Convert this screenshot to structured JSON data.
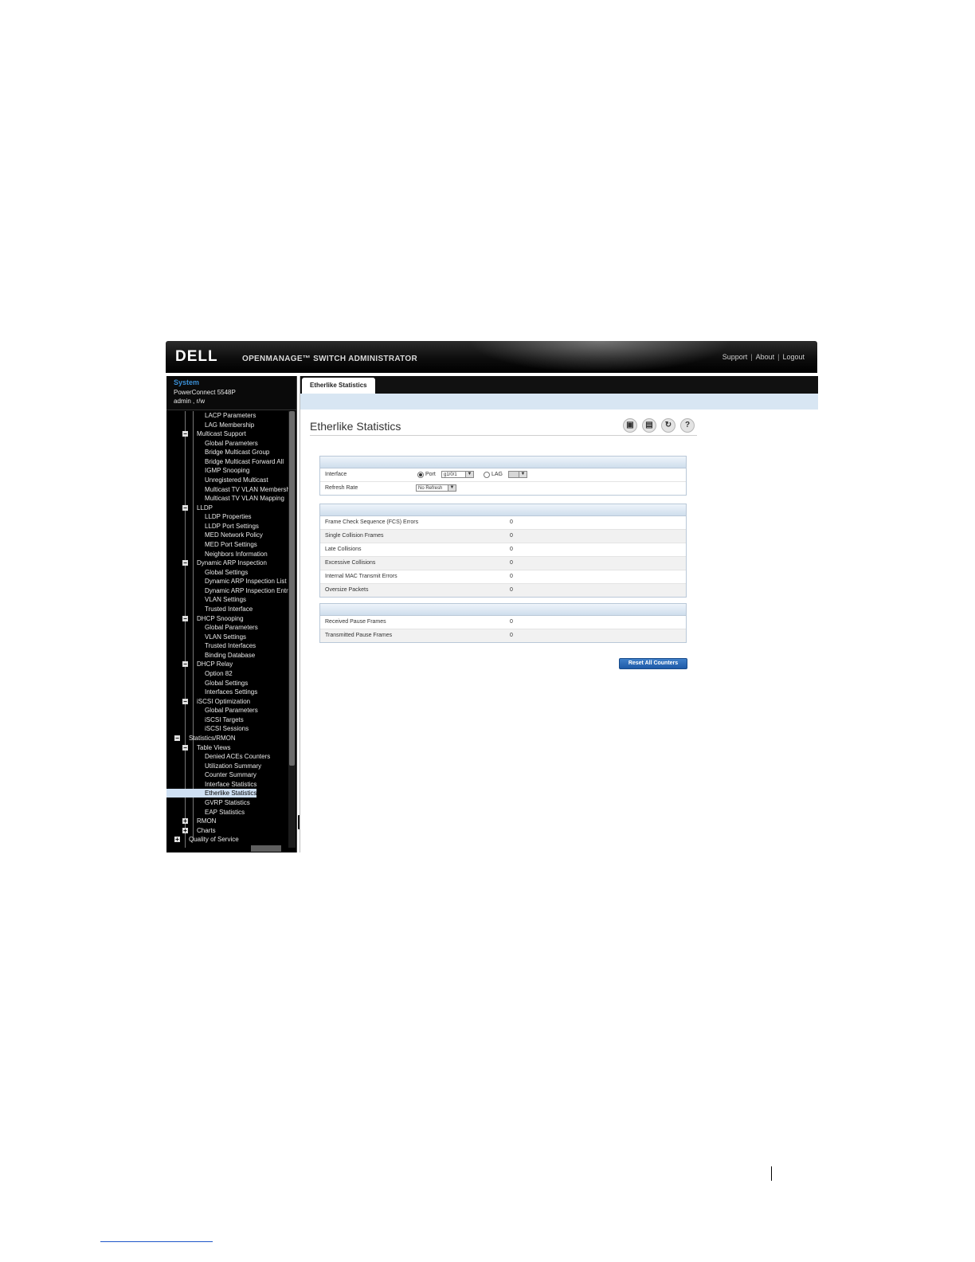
{
  "header": {
    "logo": "DELL",
    "product": "OPENMANAGE™ SWITCH ADMINISTRATOR",
    "links": [
      "Support",
      "About",
      "Logout"
    ]
  },
  "sidebar": {
    "system_title": "System",
    "model": "PowerConnect 5548P",
    "user": "admin , r/w",
    "tree": [
      {
        "label": "LACP Parameters",
        "level": 2
      },
      {
        "label": "LAG Membership",
        "level": 2
      },
      {
        "label": "Multicast Support",
        "level": 1,
        "toggle": "−"
      },
      {
        "label": "Global Parameters",
        "level": 2
      },
      {
        "label": "Bridge Multicast Group",
        "level": 2
      },
      {
        "label": "Bridge Multicast Forward All",
        "level": 2
      },
      {
        "label": "IGMP Snooping",
        "level": 2
      },
      {
        "label": "Unregistered Multicast",
        "level": 2
      },
      {
        "label": "Multicast TV VLAN Membersh",
        "level": 2
      },
      {
        "label": "Multicast TV VLAN Mapping",
        "level": 2
      },
      {
        "label": "LLDP",
        "level": 1,
        "toggle": "−"
      },
      {
        "label": "LLDP Properties",
        "level": 2
      },
      {
        "label": "LLDP Port Settings",
        "level": 2
      },
      {
        "label": "MED Network Policy",
        "level": 2
      },
      {
        "label": "MED Port Settings",
        "level": 2
      },
      {
        "label": "Neighbors Information",
        "level": 2
      },
      {
        "label": "Dynamic ARP Inspection",
        "level": 1,
        "toggle": "−"
      },
      {
        "label": "Global Settings",
        "level": 2
      },
      {
        "label": "Dynamic ARP Inspection List",
        "level": 2
      },
      {
        "label": "Dynamic ARP Inspection Entr",
        "level": 2
      },
      {
        "label": "VLAN Settings",
        "level": 2
      },
      {
        "label": "Trusted Interface",
        "level": 2
      },
      {
        "label": "DHCP Snooping",
        "level": 1,
        "toggle": "−"
      },
      {
        "label": "Global Parameters",
        "level": 2
      },
      {
        "label": "VLAN Settings",
        "level": 2
      },
      {
        "label": "Trusted Interfaces",
        "level": 2
      },
      {
        "label": "Binding Database",
        "level": 2
      },
      {
        "label": "DHCP Relay",
        "level": 1,
        "toggle": "−"
      },
      {
        "label": "Option 82",
        "level": 2
      },
      {
        "label": "Global Settings",
        "level": 2
      },
      {
        "label": "Interfaces Settings",
        "level": 2
      },
      {
        "label": "iSCSI Optimization",
        "level": 1,
        "toggle": "−"
      },
      {
        "label": "Global Parameters",
        "level": 2
      },
      {
        "label": "iSCSI Targets",
        "level": 2
      },
      {
        "label": "iSCSI Sessions",
        "level": 2
      },
      {
        "label": "Statistics/RMON",
        "level": 0,
        "toggle": "−"
      },
      {
        "label": "Table Views",
        "level": 1,
        "toggle": "−"
      },
      {
        "label": "Denied ACEs Counters",
        "level": 2
      },
      {
        "label": "Utilization Summary",
        "level": 2
      },
      {
        "label": "Counter Summary",
        "level": 2
      },
      {
        "label": "Interface Statistics",
        "level": 2
      },
      {
        "label": "Etherlike Statistics",
        "level": 2,
        "selected": true
      },
      {
        "label": "GVRP Statistics",
        "level": 2
      },
      {
        "label": "EAP Statistics",
        "level": 2
      },
      {
        "label": "RMON",
        "level": 1,
        "toggle": "+"
      },
      {
        "label": "Charts",
        "level": 1,
        "toggle": "+"
      },
      {
        "label": "Quality of Service",
        "level": 0,
        "toggle": "+"
      }
    ]
  },
  "main": {
    "tab": "Etherlike Statistics",
    "title": "Etherlike Statistics",
    "toolbar_icons": [
      "save-icon",
      "print-icon",
      "refresh-icon",
      "help-icon"
    ],
    "interface_label": "Interface",
    "port_label": "Port",
    "port_value": "g1/0/1",
    "lag_label": "LAG",
    "refresh_label": "Refresh Rate",
    "refresh_value": "No Refresh",
    "counters1": [
      {
        "label": "Frame Check Sequence (FCS) Errors",
        "value": "0"
      },
      {
        "label": "Single Collision Frames",
        "value": "0"
      },
      {
        "label": "Late Collisions",
        "value": "0"
      },
      {
        "label": "Excessive Collisions",
        "value": "0"
      },
      {
        "label": "Internal MAC Transmit Errors",
        "value": "0"
      },
      {
        "label": "Oversize Packets",
        "value": "0"
      }
    ],
    "counters2": [
      {
        "label": "Received Pause Frames",
        "value": "0"
      },
      {
        "label": "Transmitted Pause Frames",
        "value": "0"
      }
    ],
    "reset_button": "Reset All Counters"
  }
}
